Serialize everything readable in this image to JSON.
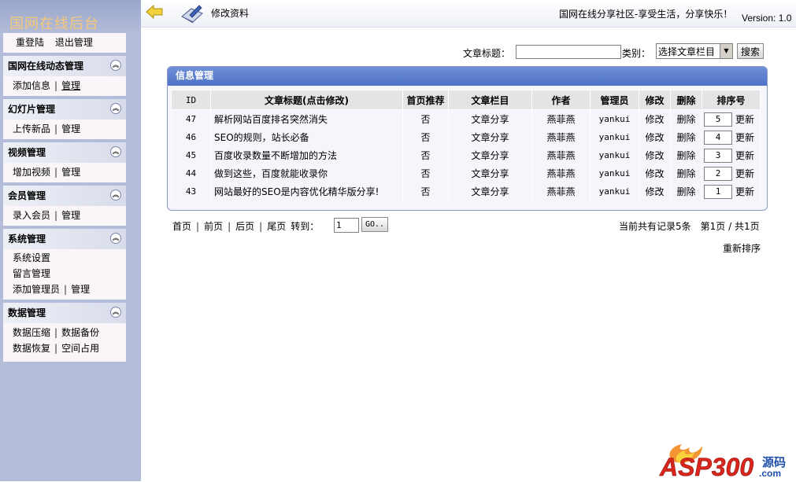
{
  "app": {
    "brand": "国网在线后台",
    "breadcrumb": "修改资料",
    "slogan": "国网在线分享社区-享受生活，分享快乐！",
    "version": "Version: 1.0"
  },
  "sidebar": {
    "top_links": {
      "relogin": "重登陆",
      "logout": "退出管理"
    },
    "sections": [
      {
        "title": "国网在线动态管理",
        "rows": [
          [
            "添加信息",
            "管理"
          ]
        ]
      },
      {
        "title": "幻灯片管理",
        "rows": [
          [
            "上传新品",
            "管理"
          ]
        ]
      },
      {
        "title": "视频管理",
        "rows": [
          [
            "增加视频",
            "管理"
          ]
        ]
      },
      {
        "title": "会员管理",
        "rows": [
          [
            "录入会员",
            "管理"
          ]
        ]
      },
      {
        "title": "系统管理",
        "rows": [
          [
            "系统设置"
          ],
          [
            "留言管理"
          ],
          [
            "添加管理员",
            "管理"
          ]
        ]
      },
      {
        "title": "数据管理",
        "rows": [
          [
            "数据压缩",
            "数据备份"
          ],
          [
            "数据恢复",
            "空间占用"
          ]
        ]
      }
    ]
  },
  "search": {
    "title_label": "文章标题：",
    "title_value": "",
    "category_label": "类别：",
    "category_selected": "选择文章栏目",
    "button": "搜索"
  },
  "panel": {
    "title": "信息管理",
    "columns": [
      "ID",
      "文章标题(点击修改)",
      "首页推荐",
      "文章栏目",
      "作者",
      "管理员",
      "修改",
      "删除",
      "排序号"
    ],
    "rows": [
      {
        "id": "47",
        "title": "解析网站百度排名突然消失",
        "featured": "否",
        "category": "文章分享",
        "author": "燕菲燕",
        "admin": "yankui",
        "edit": "修改",
        "del": "删除",
        "sort": "5",
        "update": "更新"
      },
      {
        "id": "46",
        "title": "SEO的规则，站长必备",
        "featured": "否",
        "category": "文章分享",
        "author": "燕菲燕",
        "admin": "yankui",
        "edit": "修改",
        "del": "删除",
        "sort": "4",
        "update": "更新"
      },
      {
        "id": "45",
        "title": "百度收录数量不断增加的方法",
        "featured": "否",
        "category": "文章分享",
        "author": "燕菲燕",
        "admin": "yankui",
        "edit": "修改",
        "del": "删除",
        "sort": "3",
        "update": "更新"
      },
      {
        "id": "44",
        "title": "做到这些，百度就能收录你",
        "featured": "否",
        "category": "文章分享",
        "author": "燕菲燕",
        "admin": "yankui",
        "edit": "修改",
        "del": "删除",
        "sort": "2",
        "update": "更新"
      },
      {
        "id": "43",
        "title": "网站最好的SEO是内容优化精华版分享!",
        "featured": "否",
        "category": "文章分享",
        "author": "燕菲燕",
        "admin": "yankui",
        "edit": "修改",
        "del": "删除",
        "sort": "1",
        "update": "更新"
      }
    ]
  },
  "pager": {
    "first": "首页",
    "prev": "前页",
    "next": "后页",
    "last": "尾页",
    "goto_label": "转到：",
    "goto_value": "1",
    "go_button": "GO..",
    "record_info": "当前共有记录5条　第1页 / 共1页",
    "resort": "重新排序"
  },
  "logo": {
    "text": "ASP300",
    "suffix": "源码",
    "domain": ".com"
  },
  "colors": {
    "sidebar_bg": "#b3bcd8",
    "panel_header": "#5578c9",
    "brand_text": "#f5c87a",
    "logo_red": "#d9261c",
    "logo_blue": "#1f4fa8"
  },
  "icons": [
    "back-arrow-icon",
    "book-pen-icon",
    "collapse-chevron-icon"
  ]
}
